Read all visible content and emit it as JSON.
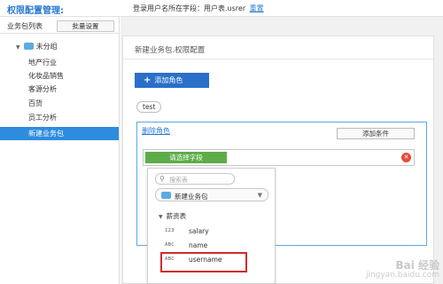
{
  "header": {
    "title": "权限配置管理:",
    "login_field_text": "登录用户名所在字段：用户表.usrer",
    "reset_label": "重置"
  },
  "sidebar": {
    "title": "业务包列表",
    "batch_button": "批量设置",
    "group_label": "未分组",
    "items": [
      {
        "label": "地产行业",
        "selected": false
      },
      {
        "label": "化妆品销售",
        "selected": false
      },
      {
        "label": "客源分析",
        "selected": false
      },
      {
        "label": "百货",
        "selected": false
      },
      {
        "label": "员工分析",
        "selected": false
      },
      {
        "label": "新建业务包",
        "selected": true
      }
    ]
  },
  "main": {
    "panel_title": "新建业务包.权限配置",
    "add_role_label": "添加角色",
    "role_tag": "test",
    "delete_role_label": "删除角色",
    "add_condition_label": "添加条件",
    "select_field_label": "请选择字段"
  },
  "dropdown": {
    "search_placeholder": "搜索表",
    "package_select": "新建业务包",
    "table_group": "薪资表",
    "fields": [
      {
        "type": "123",
        "name": "salary"
      },
      {
        "type": "ABC",
        "name": "name"
      },
      {
        "type": "ABC",
        "name": "username"
      }
    ]
  },
  "watermark": {
    "line1": "Bai 经验",
    "line2": "jingyan.baidu.com"
  },
  "colors": {
    "accent_blue": "#2a7ad2",
    "selected_bg": "#2e8cde",
    "add_role_bg": "#2a6fc9",
    "field_button_green": "#5dac48",
    "clear_red": "#e74c3c",
    "highlight_red": "#d12b2b"
  },
  "icons": {
    "folder": "folder-icon",
    "search": "search-icon",
    "tree_arrow": "triangle-down-icon",
    "clear": "close-circle-icon",
    "chevron": "chevron-down-icon"
  }
}
